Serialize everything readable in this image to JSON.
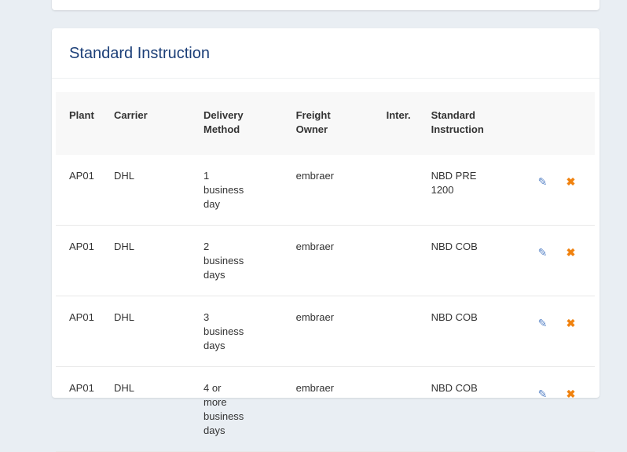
{
  "card": {
    "title": "Standard Instruction"
  },
  "table": {
    "headers": [
      "Plant",
      "Carrier",
      "Delivery Method",
      "Freight Owner",
      "Inter.",
      "Standard Instruction"
    ],
    "rows": [
      {
        "plant": "AP01",
        "carrier": "DHL",
        "delivery": "1 business day",
        "freight": "embraer",
        "inter": "",
        "std": "NBD PRE 1200"
      },
      {
        "plant": "AP01",
        "carrier": "DHL",
        "delivery": "2 business days",
        "freight": "embraer",
        "inter": "",
        "std": "NBD COB"
      },
      {
        "plant": "AP01",
        "carrier": "DHL",
        "delivery": "3 business days",
        "freight": "embraer",
        "inter": "",
        "std": "NBD COB"
      },
      {
        "plant": "AP01",
        "carrier": "DHL",
        "delivery": "4 or more business days",
        "freight": "embraer",
        "inter": "",
        "std": "NBD COB"
      }
    ]
  },
  "icons": {
    "edit": "pencil-icon",
    "delete": "times-icon"
  },
  "colors": {
    "title": "#1c3f78",
    "edit": "#5b86c8",
    "delete": "#f0820f"
  }
}
